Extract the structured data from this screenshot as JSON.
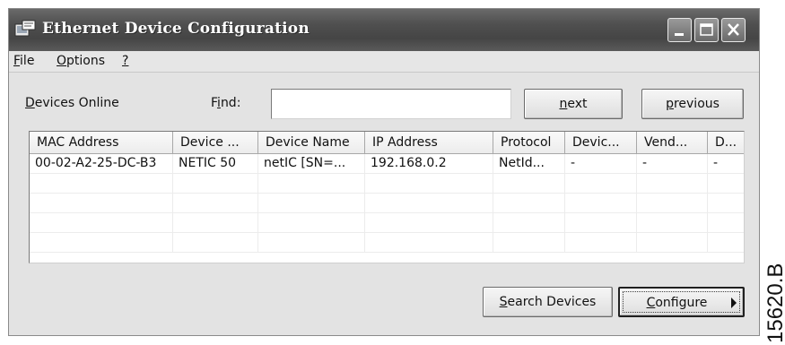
{
  "window": {
    "title": "Ethernet Device Configuration",
    "icon": "network-config-icon",
    "controls": [
      "minimize-icon",
      "maximize-icon",
      "close-icon"
    ]
  },
  "menu": {
    "file": {
      "mnemonic": "F",
      "rest": "ile"
    },
    "options": {
      "mnemonic": "O",
      "rest": "ptions"
    },
    "help": {
      "mnemonic": "?",
      "rest": ""
    }
  },
  "toolbar": {
    "devices_online": {
      "mnemonic": "D",
      "rest": "evices Online"
    },
    "find": {
      "before": "F",
      "mnemonic": "i",
      "rest": "nd:"
    },
    "find_value": "",
    "next": {
      "mnemonic": "n",
      "rest": "ext"
    },
    "previous": {
      "mnemonic": "p",
      "rest": "revious"
    }
  },
  "table": {
    "columns": [
      "MAC Address",
      "Device ...",
      "Device Name",
      "IP Address",
      "Protocol",
      "Devic...",
      "Vend...",
      "D..."
    ],
    "rows": [
      [
        "00-02-A2-25-DC-B3",
        "NETIC 50",
        "netIC [SN=...",
        "192.168.0.2",
        "NetId...",
        "-",
        "-",
        "-"
      ]
    ]
  },
  "actions": {
    "search_devices": {
      "mnemonic": "S",
      "rest": "earch Devices"
    },
    "configure": {
      "mnemonic": "C",
      "rest": "onfigure"
    }
  },
  "caption": "15620.B",
  "colors": {
    "titlebar": "#505050",
    "window_bg": "#e3e3e3",
    "table_bg": "#ffffff"
  }
}
